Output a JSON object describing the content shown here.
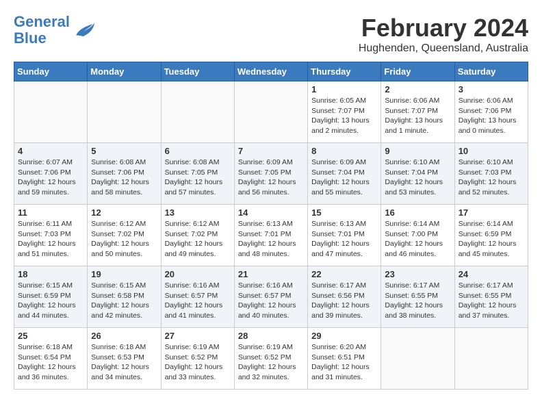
{
  "header": {
    "logo_line1": "General",
    "logo_line2": "Blue",
    "main_title": "February 2024",
    "subtitle": "Hughenden, Queensland, Australia"
  },
  "calendar": {
    "days_of_week": [
      "Sunday",
      "Monday",
      "Tuesday",
      "Wednesday",
      "Thursday",
      "Friday",
      "Saturday"
    ],
    "weeks": [
      [
        {
          "day": "",
          "info": ""
        },
        {
          "day": "",
          "info": ""
        },
        {
          "day": "",
          "info": ""
        },
        {
          "day": "",
          "info": ""
        },
        {
          "day": "1",
          "info": "Sunrise: 6:05 AM\nSunset: 7:07 PM\nDaylight: 13 hours\nand 2 minutes."
        },
        {
          "day": "2",
          "info": "Sunrise: 6:06 AM\nSunset: 7:07 PM\nDaylight: 13 hours\nand 1 minute."
        },
        {
          "day": "3",
          "info": "Sunrise: 6:06 AM\nSunset: 7:06 PM\nDaylight: 13 hours\nand 0 minutes."
        }
      ],
      [
        {
          "day": "4",
          "info": "Sunrise: 6:07 AM\nSunset: 7:06 PM\nDaylight: 12 hours\nand 59 minutes."
        },
        {
          "day": "5",
          "info": "Sunrise: 6:08 AM\nSunset: 7:06 PM\nDaylight: 12 hours\nand 58 minutes."
        },
        {
          "day": "6",
          "info": "Sunrise: 6:08 AM\nSunset: 7:05 PM\nDaylight: 12 hours\nand 57 minutes."
        },
        {
          "day": "7",
          "info": "Sunrise: 6:09 AM\nSunset: 7:05 PM\nDaylight: 12 hours\nand 56 minutes."
        },
        {
          "day": "8",
          "info": "Sunrise: 6:09 AM\nSunset: 7:04 PM\nDaylight: 12 hours\nand 55 minutes."
        },
        {
          "day": "9",
          "info": "Sunrise: 6:10 AM\nSunset: 7:04 PM\nDaylight: 12 hours\nand 53 minutes."
        },
        {
          "day": "10",
          "info": "Sunrise: 6:10 AM\nSunset: 7:03 PM\nDaylight: 12 hours\nand 52 minutes."
        }
      ],
      [
        {
          "day": "11",
          "info": "Sunrise: 6:11 AM\nSunset: 7:03 PM\nDaylight: 12 hours\nand 51 minutes."
        },
        {
          "day": "12",
          "info": "Sunrise: 6:12 AM\nSunset: 7:02 PM\nDaylight: 12 hours\nand 50 minutes."
        },
        {
          "day": "13",
          "info": "Sunrise: 6:12 AM\nSunset: 7:02 PM\nDaylight: 12 hours\nand 49 minutes."
        },
        {
          "day": "14",
          "info": "Sunrise: 6:13 AM\nSunset: 7:01 PM\nDaylight: 12 hours\nand 48 minutes."
        },
        {
          "day": "15",
          "info": "Sunrise: 6:13 AM\nSunset: 7:01 PM\nDaylight: 12 hours\nand 47 minutes."
        },
        {
          "day": "16",
          "info": "Sunrise: 6:14 AM\nSunset: 7:00 PM\nDaylight: 12 hours\nand 46 minutes."
        },
        {
          "day": "17",
          "info": "Sunrise: 6:14 AM\nSunset: 6:59 PM\nDaylight: 12 hours\nand 45 minutes."
        }
      ],
      [
        {
          "day": "18",
          "info": "Sunrise: 6:15 AM\nSunset: 6:59 PM\nDaylight: 12 hours\nand 44 minutes."
        },
        {
          "day": "19",
          "info": "Sunrise: 6:15 AM\nSunset: 6:58 PM\nDaylight: 12 hours\nand 42 minutes."
        },
        {
          "day": "20",
          "info": "Sunrise: 6:16 AM\nSunset: 6:57 PM\nDaylight: 12 hours\nand 41 minutes."
        },
        {
          "day": "21",
          "info": "Sunrise: 6:16 AM\nSunset: 6:57 PM\nDaylight: 12 hours\nand 40 minutes."
        },
        {
          "day": "22",
          "info": "Sunrise: 6:17 AM\nSunset: 6:56 PM\nDaylight: 12 hours\nand 39 minutes."
        },
        {
          "day": "23",
          "info": "Sunrise: 6:17 AM\nSunset: 6:55 PM\nDaylight: 12 hours\nand 38 minutes."
        },
        {
          "day": "24",
          "info": "Sunrise: 6:17 AM\nSunset: 6:55 PM\nDaylight: 12 hours\nand 37 minutes."
        }
      ],
      [
        {
          "day": "25",
          "info": "Sunrise: 6:18 AM\nSunset: 6:54 PM\nDaylight: 12 hours\nand 36 minutes."
        },
        {
          "day": "26",
          "info": "Sunrise: 6:18 AM\nSunset: 6:53 PM\nDaylight: 12 hours\nand 34 minutes."
        },
        {
          "day": "27",
          "info": "Sunrise: 6:19 AM\nSunset: 6:52 PM\nDaylight: 12 hours\nand 33 minutes."
        },
        {
          "day": "28",
          "info": "Sunrise: 6:19 AM\nSunset: 6:52 PM\nDaylight: 12 hours\nand 32 minutes."
        },
        {
          "day": "29",
          "info": "Sunrise: 6:20 AM\nSunset: 6:51 PM\nDaylight: 12 hours\nand 31 minutes."
        },
        {
          "day": "",
          "info": ""
        },
        {
          "day": "",
          "info": ""
        }
      ]
    ]
  }
}
